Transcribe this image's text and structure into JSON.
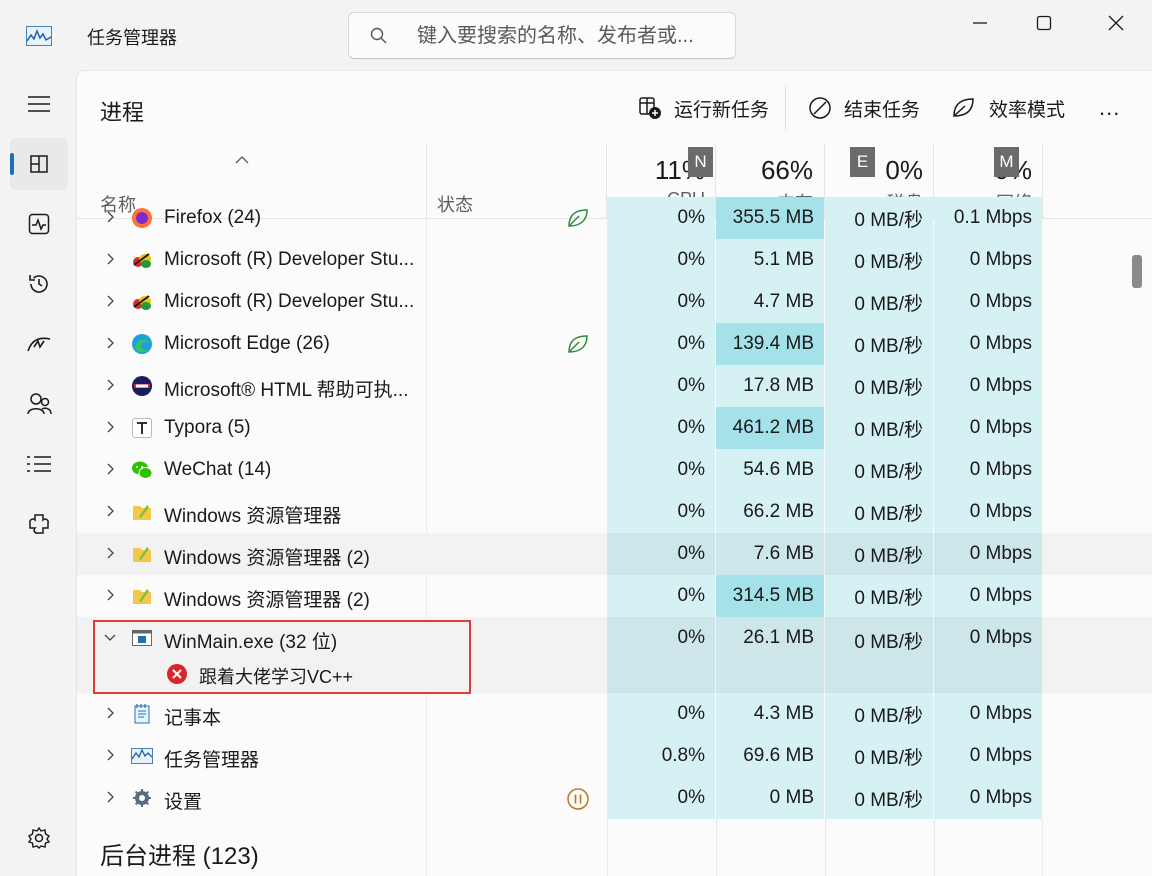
{
  "app": {
    "title": "任务管理器",
    "icon": "task-manager-icon"
  },
  "search": {
    "placeholder": "键入要搜索的名称、发布者或..."
  },
  "nav": [
    "hamburger-icon",
    "processes-icon",
    "performance-icon",
    "app-history-icon",
    "startup-icon",
    "users-icon",
    "details-icon",
    "services-icon",
    "settings-icon"
  ],
  "page": {
    "title": "进程"
  },
  "toolbar": {
    "run_new_task": "运行新任务",
    "end_task": "结束任务",
    "efficiency_mode": "效率模式",
    "more": "..."
  },
  "columns": {
    "name": "名称",
    "status": "状态",
    "cpu": {
      "pct": "11%",
      "label": "CPU"
    },
    "memory": {
      "pct": "66%",
      "label": "内存"
    },
    "disk": {
      "pct": "0%",
      "label": "磁盘"
    },
    "network": {
      "pct": "0%",
      "label": "网络"
    }
  },
  "overlay_tags": [
    "N",
    "E",
    "M"
  ],
  "processes": [
    {
      "name": "Firefox (24)",
      "cpu": "0%",
      "mem": "355.5 MB",
      "disk": "0 MB/秒",
      "net": "0.1 Mbps",
      "mem_hi": true,
      "status": "leaf"
    },
    {
      "name": "Microsoft (R) Developer Stu...",
      "cpu": "0%",
      "mem": "5.1 MB",
      "disk": "0 MB/秒",
      "net": "0 Mbps"
    },
    {
      "name": "Microsoft (R) Developer Stu...",
      "cpu": "0%",
      "mem": "4.7 MB",
      "disk": "0 MB/秒",
      "net": "0 Mbps"
    },
    {
      "name": "Microsoft Edge (26)",
      "cpu": "0%",
      "mem": "139.4 MB",
      "disk": "0 MB/秒",
      "net": "0 Mbps",
      "mem_hi": true,
      "status": "leaf"
    },
    {
      "name": "Microsoft® HTML 帮助可执...",
      "cpu": "0%",
      "mem": "17.8 MB",
      "disk": "0 MB/秒",
      "net": "0 Mbps"
    },
    {
      "name": "Typora (5)",
      "cpu": "0%",
      "mem": "461.2 MB",
      "disk": "0 MB/秒",
      "net": "0 Mbps",
      "mem_hi": true
    },
    {
      "name": "WeChat (14)",
      "cpu": "0%",
      "mem": "54.6 MB",
      "disk": "0 MB/秒",
      "net": "0 Mbps"
    },
    {
      "name": "Windows 资源管理器",
      "cpu": "0%",
      "mem": "66.2 MB",
      "disk": "0 MB/秒",
      "net": "0 Mbps"
    },
    {
      "name": "Windows 资源管理器 (2)",
      "cpu": "0%",
      "mem": "7.6 MB",
      "disk": "0 MB/秒",
      "net": "0 Mbps"
    },
    {
      "name": "Windows 资源管理器 (2)",
      "cpu": "0%",
      "mem": "314.5 MB",
      "disk": "0 MB/秒",
      "net": "0 Mbps",
      "mem_hi": true
    },
    {
      "name": "WinMain.exe (32 位)",
      "cpu": "0%",
      "mem": "26.1 MB",
      "disk": "0 MB/秒",
      "net": "0 Mbps",
      "expanded": true,
      "child": "跟着大佬学习VC++"
    },
    {
      "name": "记事本",
      "cpu": "0%",
      "mem": "4.3 MB",
      "disk": "0 MB/秒",
      "net": "0 Mbps"
    },
    {
      "name": "任务管理器",
      "cpu": "0.8%",
      "mem": "69.6 MB",
      "disk": "0 MB/秒",
      "net": "0 Mbps"
    },
    {
      "name": "设置",
      "cpu": "0%",
      "mem": "0 MB",
      "disk": "0 MB/秒",
      "net": "0 Mbps",
      "status": "paused"
    }
  ],
  "background": {
    "title": "后台进程 (123)"
  }
}
